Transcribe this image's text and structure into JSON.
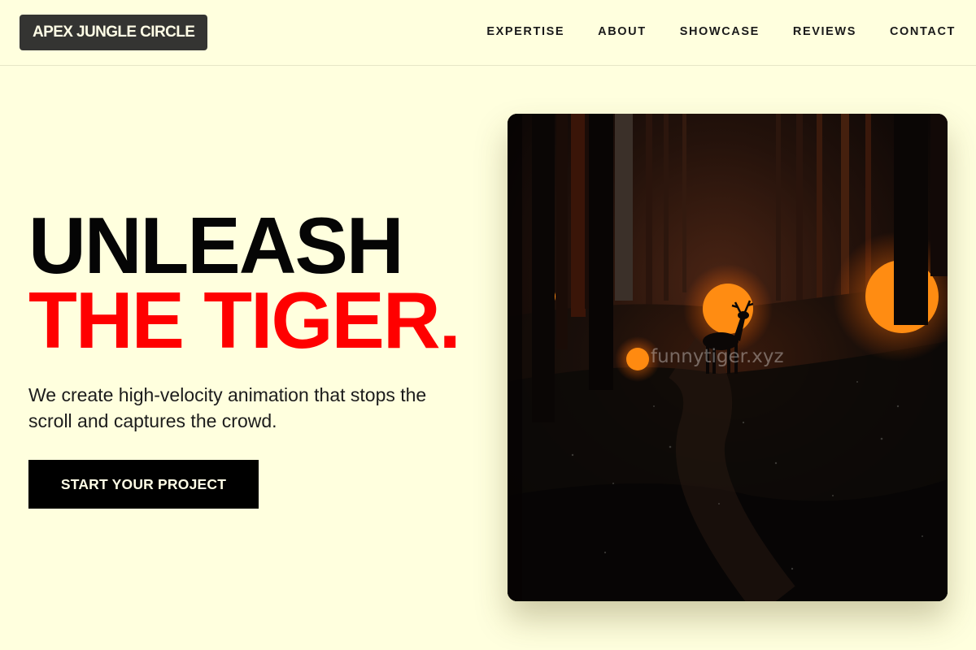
{
  "brand": {
    "name": "APEX JUNGLE CIRCLE"
  },
  "nav": {
    "items": [
      {
        "label": "EXPERTISE"
      },
      {
        "label": "ABOUT"
      },
      {
        "label": "SHOWCASE"
      },
      {
        "label": "REVIEWS"
      },
      {
        "label": "CONTACT"
      }
    ]
  },
  "hero": {
    "title_line1": "UNLEASH",
    "title_line2": "THE TIGER.",
    "subtitle": "We create high-velocity animation that stops the scroll and captures the crowd.",
    "cta_label": "START YOUR PROJECT"
  },
  "artwork": {
    "description_icon": "forest-deer-scene",
    "watermark": "funnytiger.xyz"
  },
  "colors": {
    "background": "#ffffde",
    "accent": "#ff0000",
    "logo_bg": "#343432",
    "cta_bg": "#000000"
  }
}
